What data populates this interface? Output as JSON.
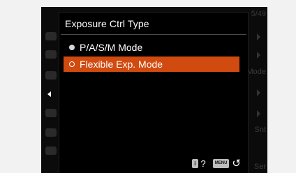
{
  "dialog": {
    "title": "Exposure Ctrl Type",
    "options": [
      {
        "label": "P/A/S/M Mode",
        "selected": false
      },
      {
        "label": "Flexible Exp. Mode",
        "selected": true
      }
    ]
  },
  "footer": {
    "help_key": "i",
    "help_glyph": "?",
    "menu_key": "MENU",
    "back_glyph": "↺"
  },
  "background_menu": {
    "right_fragments": [
      "5/49",
      "Mode",
      "Snt",
      "Ser"
    ]
  },
  "colors": {
    "accent": "#d14a0f",
    "dialog_bg": "#000000",
    "text": "#ffffff"
  }
}
